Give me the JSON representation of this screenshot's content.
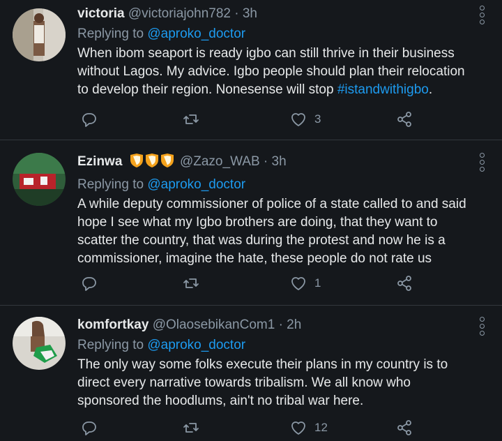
{
  "tweets": [
    {
      "name": "victoria",
      "handle": "@victoriajohn782",
      "time": "· 3h",
      "replying_label": "Replying to",
      "replying_to": "@aproko_doctor",
      "text": "When ibom seaport is ready igbo can still thrive in their business without Lagos. My advice. Igbo people should plan their relocation to develop their region. Nonesense will stop ",
      "hashtag": "#istandwithigbo",
      "text_end": ".",
      "likes": "3"
    },
    {
      "name": "Ezinwa",
      "handle": "@Zazo_WAB",
      "time": "· 3h",
      "replying_label": "Replying to",
      "replying_to": "@aproko_doctor",
      "text": "A while deputy commissioner of police of a state called to and said hope I see what my Igbo brothers are doing, that they want to scatter the country, that was during the protest and now he is a commissioner, imagine the hate, these people do not rate us",
      "likes": "1"
    },
    {
      "name": "komfortkay",
      "handle": "@OlaosebikanCom1",
      "time": "· 2h",
      "replying_label": "Replying to",
      "replying_to": "@aproko_doctor",
      "text": "The only way some folks execute their plans in my country is to direct every narrative towards tribalism. We all know who sponsored the hoodlums, ain't no tribal war here.",
      "likes": "12"
    }
  ],
  "icons": {
    "reply": "reply-icon",
    "retweet": "retweet-icon",
    "like": "heart-icon",
    "share": "share-icon",
    "more": "more-icon",
    "badge": "shield-badge-icon"
  },
  "colors": {
    "background": "#15181c",
    "link": "#1d9bf0",
    "muted": "#8b98a5",
    "badge": "#f4a21c"
  }
}
